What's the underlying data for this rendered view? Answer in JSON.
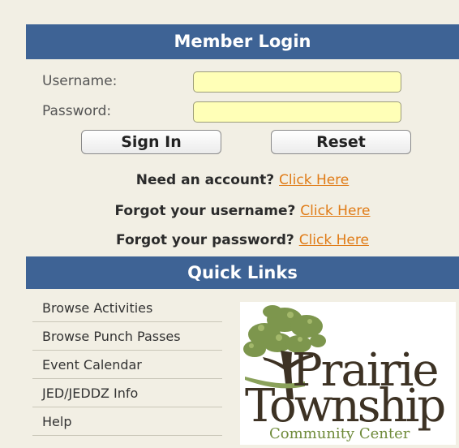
{
  "login": {
    "header": "Member Login",
    "username_label": "Username:",
    "password_label": "Password:",
    "username_value": "",
    "password_value": "",
    "sign_in_label": "Sign In",
    "reset_label": "Reset",
    "need_account_text": "Need an account?",
    "forgot_username_text": "Forgot your username?",
    "forgot_password_text": "Forgot your password?",
    "click_here_label": "Click Here"
  },
  "quick_links": {
    "header": "Quick Links",
    "items": [
      {
        "label": "Browse Activities"
      },
      {
        "label": "Browse Punch Passes"
      },
      {
        "label": "Event Calendar"
      },
      {
        "label": "JED/JEDDZ Info"
      },
      {
        "label": "Help"
      }
    ]
  },
  "logo": {
    "word1": "Prairie",
    "word2": "Township",
    "word3": "Community Center"
  },
  "colors": {
    "header_bg": "#3e6395",
    "link": "#e07b16",
    "input_bg": "#ffffb7",
    "page_bg": "#f2efe4"
  }
}
